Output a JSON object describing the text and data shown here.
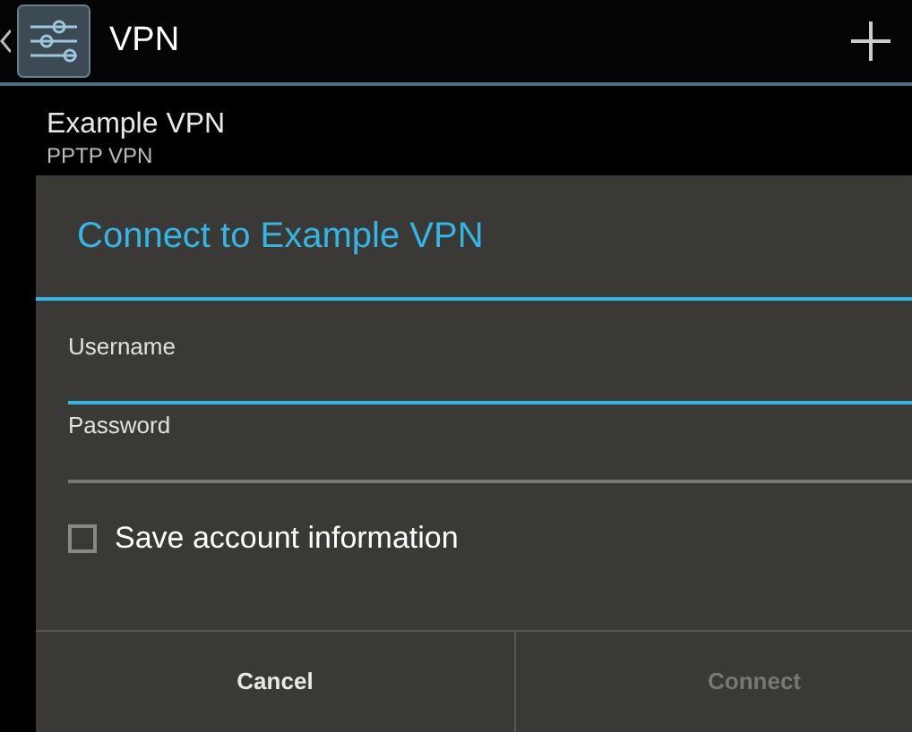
{
  "action_bar": {
    "title": "VPN"
  },
  "vpn_list": [
    {
      "name": "Example VPN",
      "type": "PPTP VPN"
    }
  ],
  "dialog": {
    "title": "Connect to Example VPN",
    "fields": [
      {
        "label": "Username",
        "focused": true
      },
      {
        "label": "Password",
        "focused": false
      }
    ],
    "checkbox": {
      "label": "Save account information",
      "checked": false
    },
    "buttons": [
      {
        "label": "Cancel",
        "disabled": false
      },
      {
        "label": "Connect",
        "disabled": true
      }
    ]
  }
}
